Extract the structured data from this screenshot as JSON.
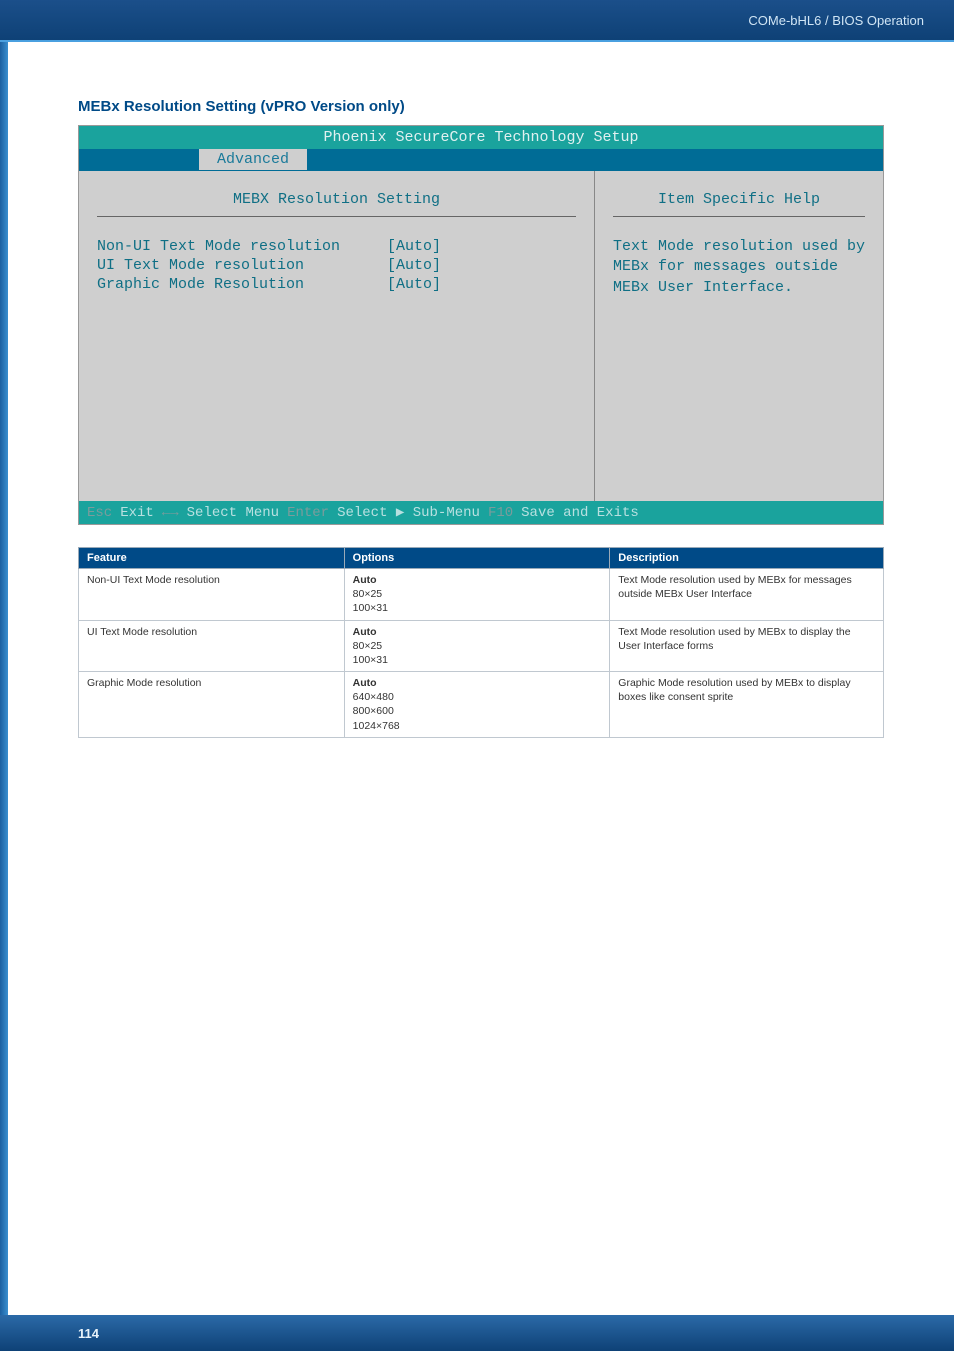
{
  "header": {
    "breadcrumb": "COMe-bHL6 / BIOS Operation"
  },
  "section_title": "MEBx Resolution Setting (vPRO Version only)",
  "bios": {
    "title": "Phoenix SecureCore Technology Setup",
    "active_tab": "Advanced",
    "left_heading": "MEBX Resolution Setting",
    "right_heading": "Item Specific Help",
    "rows": [
      {
        "label": "Non-UI Text Mode resolution",
        "value": "[Auto]"
      },
      {
        "label": "UI Text Mode resolution",
        "value": "[Auto]"
      },
      {
        "label": "Graphic Mode Resolution",
        "value": "[Auto]"
      }
    ],
    "help_text": "Text Mode resolution used by MEBx for messages outside MEBx User Interface.",
    "footer": {
      "esc": "Esc",
      "exit": "Exit",
      "arrows": "←→",
      "select_menu": "Select Menu",
      "enter": "Enter",
      "select_sub": "Select ▶ Sub-Menu",
      "f10": "F10",
      "save": "Save and Exits"
    }
  },
  "table": {
    "headers": [
      "Feature",
      "Options",
      "Description"
    ],
    "rows": [
      {
        "feature": "Non-UI Text Mode resolution",
        "opt_first": "Auto",
        "opt_rest": "80×25\n100×31",
        "desc": "Text Mode resolution used by MEBx for messages outside MEBx User Interface"
      },
      {
        "feature": "UI Text Mode resolution",
        "opt_first": "Auto",
        "opt_rest": "80×25\n100×31",
        "desc": "Text Mode resolution used by MEBx to display the User Interface forms"
      },
      {
        "feature": "Graphic Mode resolution",
        "opt_first": "Auto",
        "opt_rest": "640×480\n800×600\n1024×768",
        "desc": "Graphic Mode resolution used by MEBx to display boxes like consent sprite"
      }
    ]
  },
  "page_number": "114",
  "chart_data": {
    "type": "table",
    "title": "MEBx Resolution Setting options",
    "columns": [
      "Feature",
      "Options",
      "Description"
    ],
    "rows": [
      [
        "Non-UI Text Mode resolution",
        "Auto; 80×25; 100×31",
        "Text Mode resolution used by MEBx for messages outside MEBx User Interface"
      ],
      [
        "UI Text Mode resolution",
        "Auto; 80×25; 100×31",
        "Text Mode resolution used by MEBx to display the User Interface forms"
      ],
      [
        "Graphic Mode resolution",
        "Auto; 640×480; 800×600; 1024×768",
        "Graphic Mode resolution used by MEBx to display boxes like consent sprite"
      ]
    ]
  }
}
